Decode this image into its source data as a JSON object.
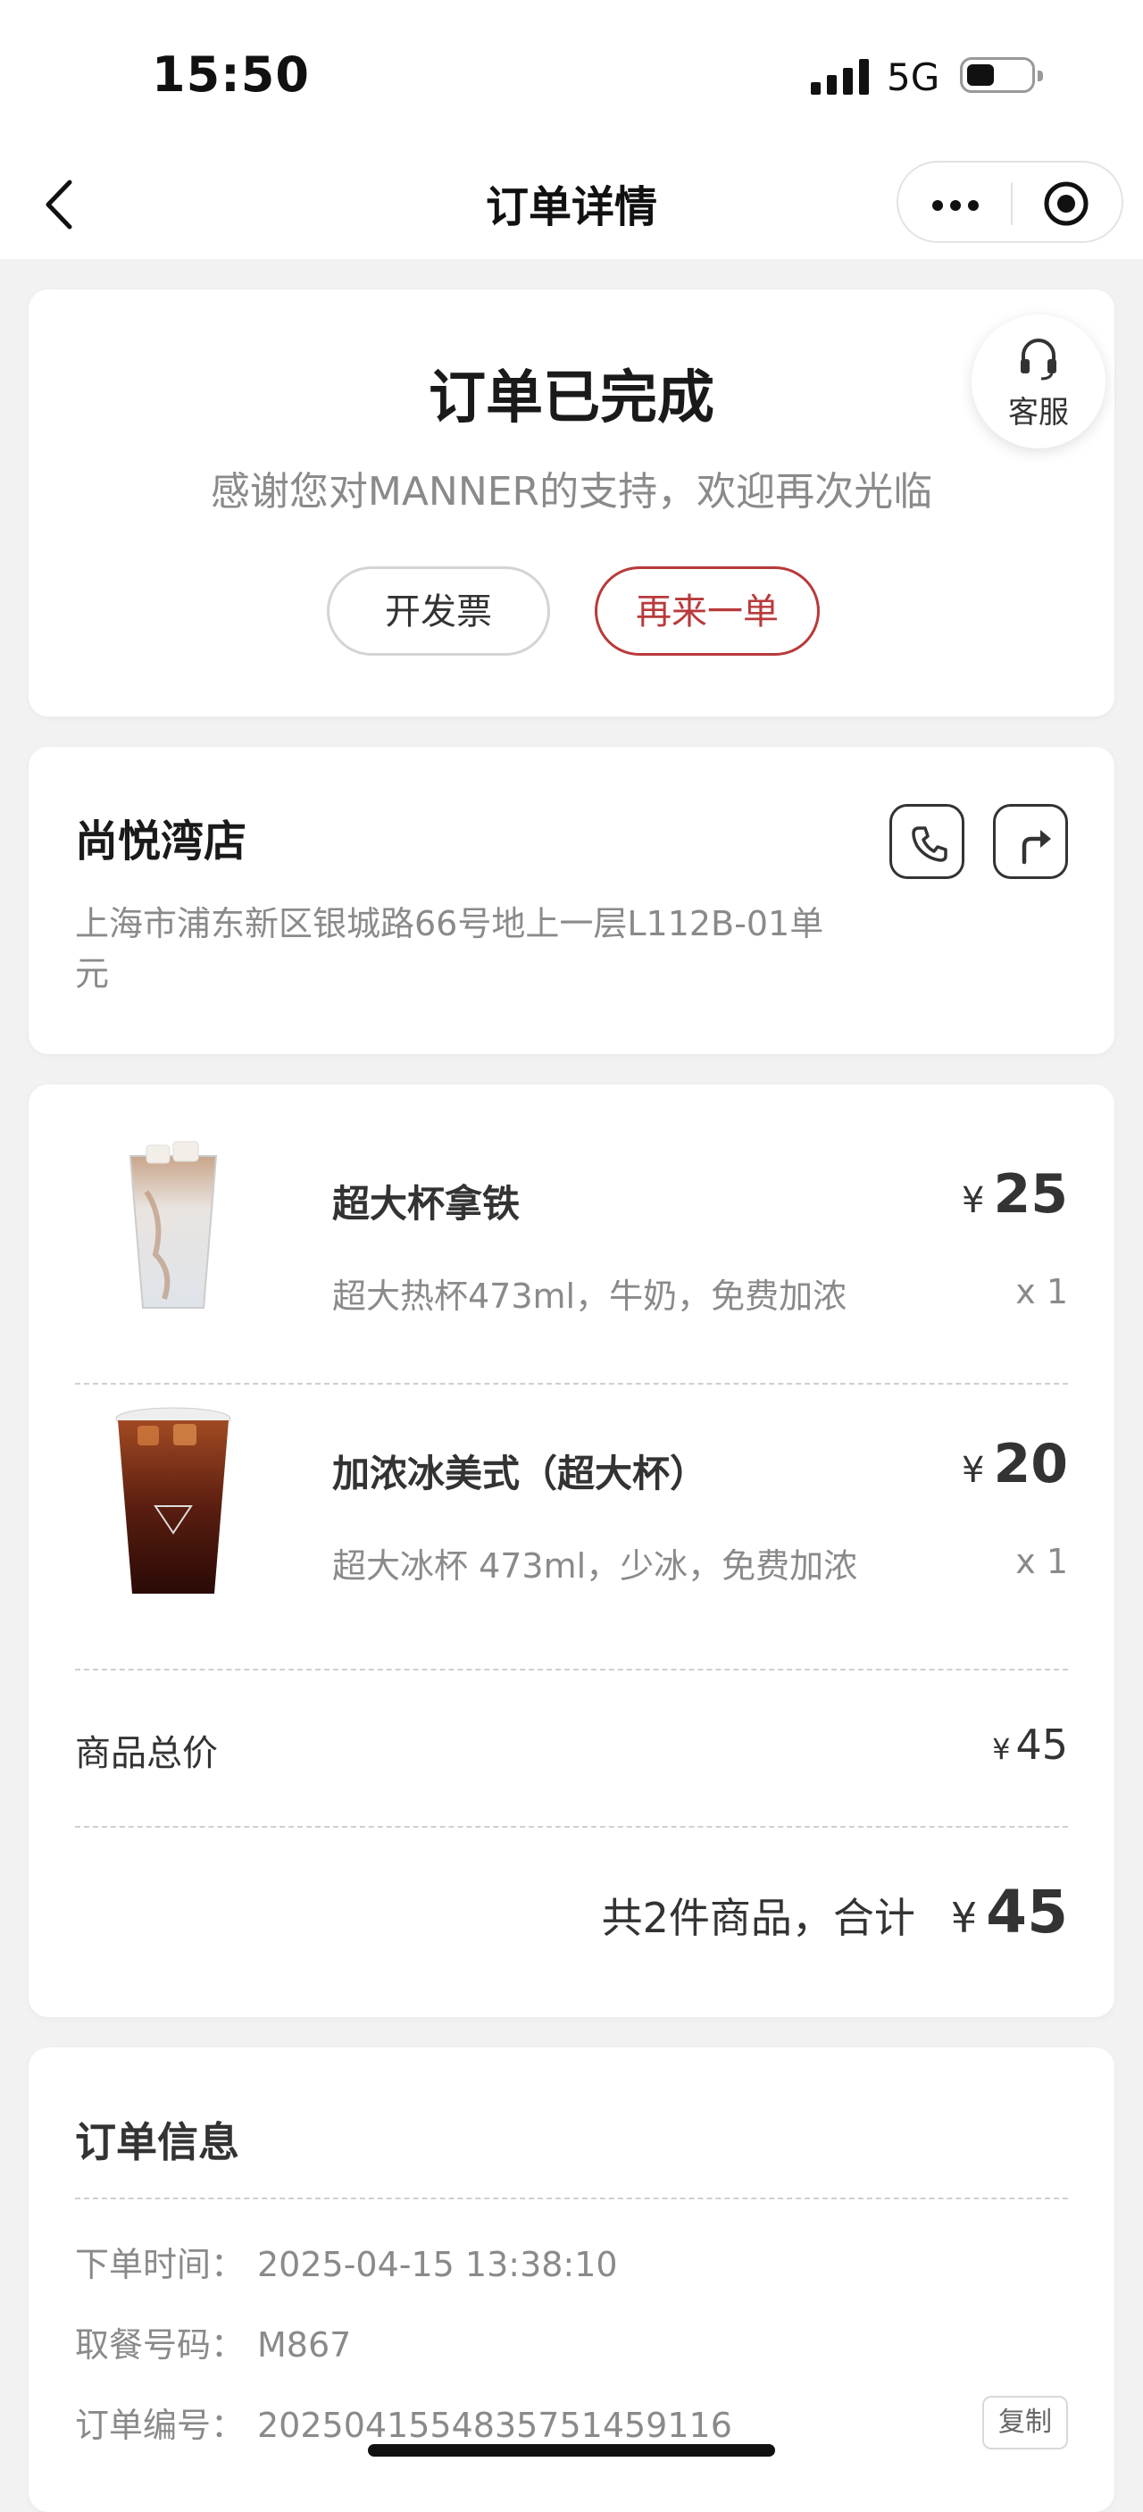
{
  "status_bar": {
    "time": "15:50",
    "network": "5G"
  },
  "nav": {
    "title": "订单详情"
  },
  "order_status": {
    "title": "订单已完成",
    "subtitle": "感谢您对MANNER的支持，欢迎再次光临",
    "invoice_button": "开发票",
    "reorder_button": "再来一单",
    "service_label": "客服"
  },
  "store": {
    "name": "尚悦湾店",
    "address": "上海市浦东新区银城路66号地上一层L112B-01单元"
  },
  "items": [
    {
      "name": "超大杯拿铁",
      "spec": "超大热杯473ml，牛奶，免费加浓",
      "currency": "¥",
      "price": "25",
      "qty": "x 1"
    },
    {
      "name": "加浓冰美式（超大杯）",
      "spec": "超大冰杯 473ml，少冰，免费加浓",
      "currency": "¥",
      "price": "20",
      "qty": "x 1"
    }
  ],
  "summary": {
    "subtotal_label": "商品总价",
    "subtotal_currency": "¥",
    "subtotal_value": "45",
    "total_text": "共2件商品，合计",
    "total_currency": "¥",
    "total_value": "45"
  },
  "order_info": {
    "title": "订单信息",
    "rows": [
      {
        "label": "下单时间：",
        "value": "2025-04-15 13:38:10"
      },
      {
        "label": "取餐号码：",
        "value": "M867"
      },
      {
        "label": "订单编号：",
        "value": "20250415548357514591​16"
      }
    ],
    "copy_label": "复制"
  },
  "colors": {
    "accent": "#b83a3a",
    "background": "#f2f2f2"
  },
  "icons": [
    "back-arrow-icon",
    "more-dots-icon",
    "record-target-icon",
    "headset-icon",
    "phone-icon",
    "route-icon"
  ]
}
